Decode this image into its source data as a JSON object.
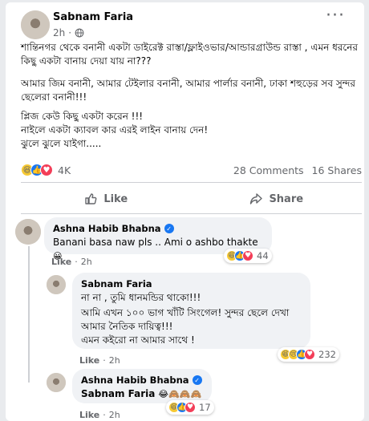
{
  "post": {
    "author": "Sabnam Faria",
    "time": "2h",
    "separator": "·",
    "more": "···",
    "paragraphs": [
      "শান্তিনগর থেকে বনানী একটা ডাইরেক্ট রাস্তা/ফ্লাইওভার/আন্ডারগ্রাউন্ড রাস্তা , এমন ধরনের কিছু একটা বানায় দেয়া যায় না???",
      "আমার জিম বনানী, আমার টেইলার বনানী, আমার পার্লার বনানী, ঢাকা শহুড়ের সব সুন্দর ছেলেরা বনানী!!!",
      "প্লিজ কেউ কিছু একটা করেন !!!\nনাইলে একটা ক্যাবল কার এরই লাইন বানায় দেন!\nঝুলে ঝুলে যাইগা....."
    ],
    "reaction_count": "4K",
    "comments_count": "28 Comments",
    "shares_count": "16 Shares"
  },
  "actions": {
    "like_label": "Like",
    "share_label": "Share"
  },
  "comments": [
    {
      "author": "Ashna Habib Bhabna",
      "text": "Banani basa naw pls .. Ami o ashbo thakte",
      "emoji": "😀",
      "like_label": "Like",
      "time": "2h",
      "reaction_count": "44"
    },
    {
      "author": "Sabnam Faria",
      "lines": [
        "না না , তুমি ধানমন্ডির থাকো!!!",
        "আমি এখন ১০০ ভাগ খাঁটি সিংগেল! সুন্দর ছেলে দেখা আমার নৈতিক দায়িত্ব!!!\nএমন কইরো না আমার সাথে !"
      ],
      "like_label": "Like",
      "time": "2h",
      "reaction_count": "232"
    },
    {
      "author": "Ashna Habib Bhabna",
      "mention": "Sabnam Faria",
      "emojis": "😂🙈🙈🙈",
      "like_label": "Like",
      "time": "2h",
      "reaction_count": "17"
    }
  ],
  "icons": {
    "globe": "globe-icon",
    "like": "thumbs-up-icon",
    "share": "share-arrow-icon",
    "verified": "verified-badge-icon"
  },
  "colors": {
    "accent": "#1877f2",
    "love": "#f33e58",
    "haha": "#f7c933",
    "muted": "#65676b"
  }
}
